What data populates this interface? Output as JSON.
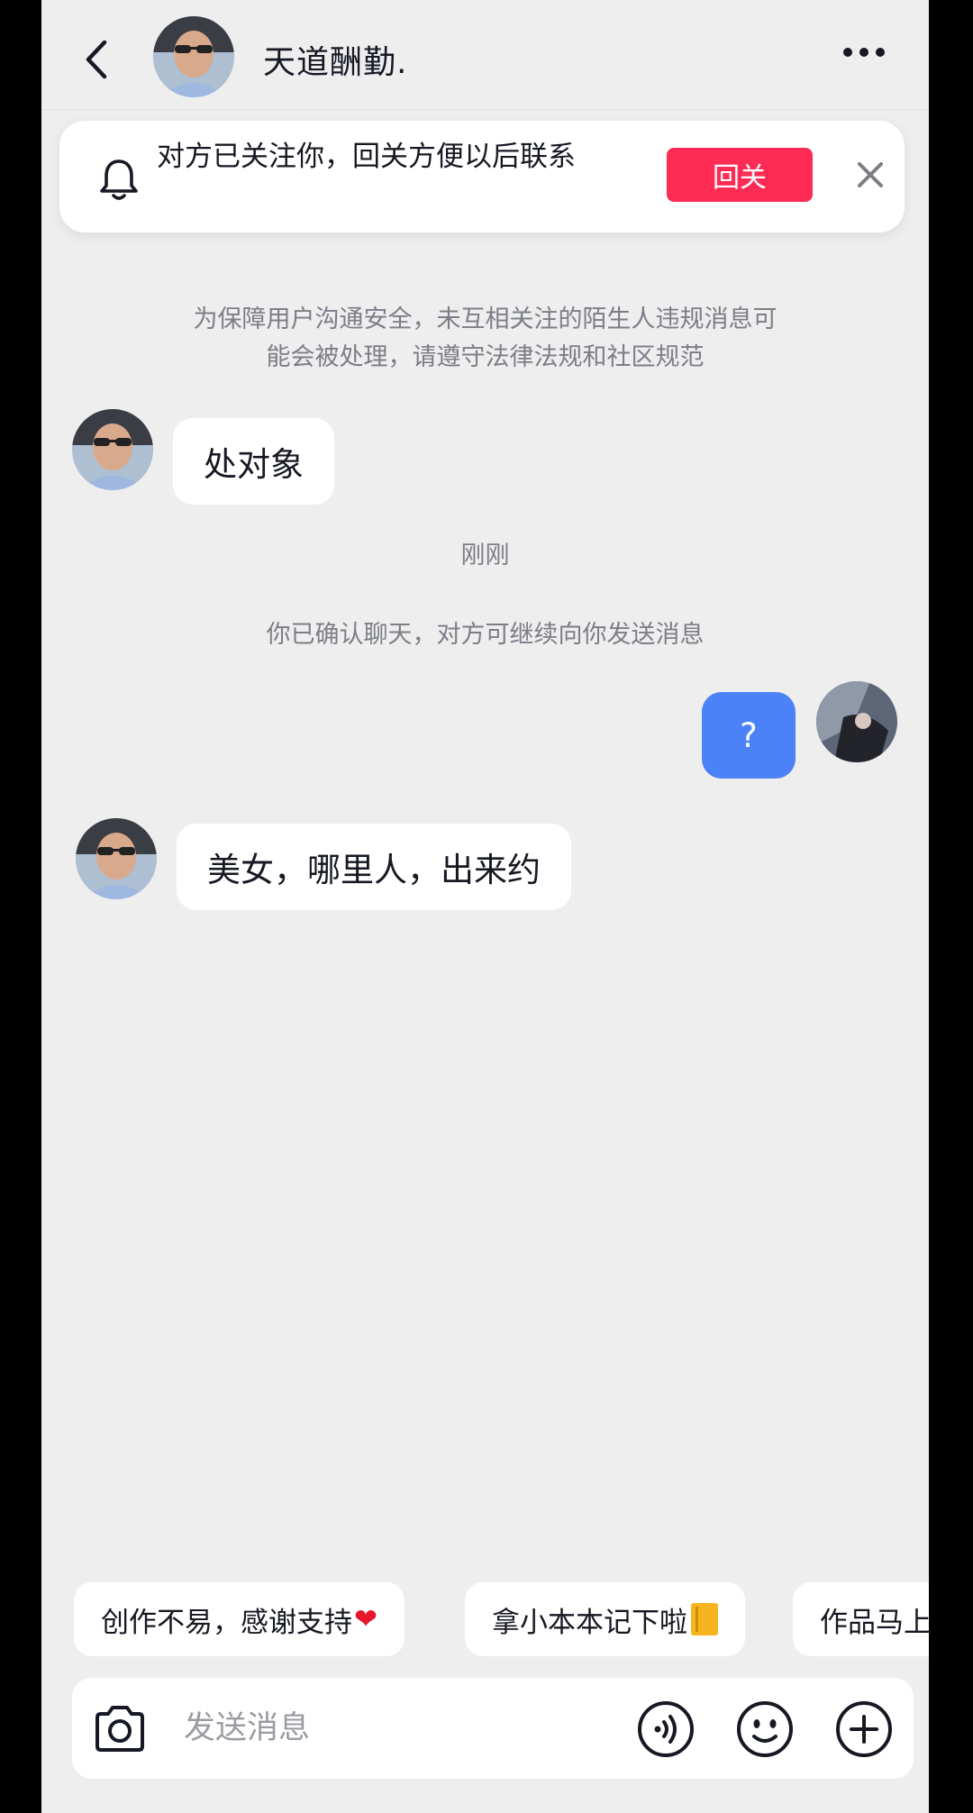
{
  "header": {
    "name": "天道酬勤.",
    "back_icon": "chevron-left-icon",
    "more_icon": "more-horizontal-icon"
  },
  "banner": {
    "text": "对方已关注你，回关方便以后联系",
    "follow_label": "回关",
    "bell_icon": "bell-icon",
    "close_icon": "close-icon",
    "accent": "#fe2c55"
  },
  "system": {
    "safety_line1": "为保障用户沟通安全，未互相关注的陌生人违规消息可",
    "safety_line2": "能会被处理，请遵守法律法规和社区规范",
    "timestamp": "刚刚",
    "confirmed": "你已确认聊天，对方可继续向你发送消息"
  },
  "messages": [
    {
      "from": "other",
      "text": "处对象"
    },
    {
      "from": "me",
      "text": "?"
    },
    {
      "from": "other",
      "text": "美女，哪里人，出来约"
    }
  ],
  "quick_replies": [
    {
      "text": "创作不易，感谢支持",
      "emoji": "❤️"
    },
    {
      "text": "拿小本本记下啦",
      "emoji": "📒"
    },
    {
      "text": "作品马上"
    }
  ],
  "input": {
    "placeholder": "发送消息",
    "value": "",
    "icons": [
      "camera-icon",
      "voice-icon",
      "emoji-icon",
      "plus-icon"
    ]
  },
  "colors": {
    "background": "#eeeeef",
    "my_bubble": "#4b82f8"
  }
}
